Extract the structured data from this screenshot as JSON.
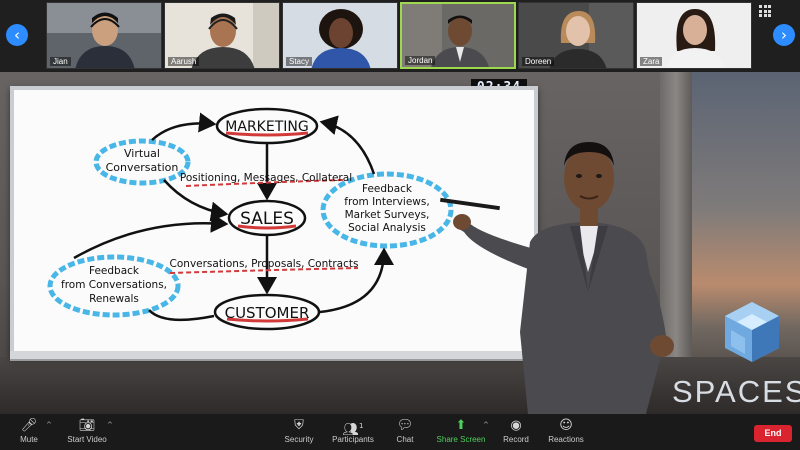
{
  "participants": [
    {
      "name": "Jian",
      "active": false,
      "skin": "#caa07e",
      "shirt": "#2a2f3a",
      "bg": "#8a8f96"
    },
    {
      "name": "Aarush",
      "active": false,
      "skin": "#a87452",
      "shirt": "#3d3d3d",
      "bg": "#e7e3da"
    },
    {
      "name": "Stacy",
      "active": false,
      "skin": "#6b4330",
      "shirt": "#2f56a8",
      "bg": "#d5dce4"
    },
    {
      "name": "Jordan",
      "active": true,
      "skin": "#6f4a33",
      "shirt": "#4a4a4f",
      "bg": "#6b6966"
    },
    {
      "name": "Doreen",
      "active": false,
      "skin": "#e3c2ab",
      "shirt": "#2b2b2b",
      "bg": "#4a4a4a"
    },
    {
      "name": "Zara",
      "active": false,
      "skin": "#d8b098",
      "shirt": "#f2f2f2",
      "bg": "#efefef"
    }
  ],
  "timer": "02:34",
  "whiteboard": {
    "marketing": "MARKETING",
    "sales": "SALES",
    "customer": "CUSTOMER",
    "virtual_line1": "Virtual",
    "virtual_line2": "Conversation",
    "positioning": "Positioning, Messages, Collateral",
    "conversations": "Conversations, Proposals, Contracts",
    "fb_right_line1": "Feedback",
    "fb_right_line2": "from Interviews,",
    "fb_right_line3": "Market Surveys,",
    "fb_right_line4": "Social Analysis",
    "fb_left_line1": "Feedback",
    "fb_left_line2": "from Conversations,",
    "fb_left_line3": "Renewals"
  },
  "brand": "SPACES",
  "toolbar": {
    "mute": "Mute",
    "start_video": "Start Video",
    "security": "Security",
    "participants": "Participants",
    "participants_count": "1",
    "chat": "Chat",
    "share_screen": "Share Screen",
    "record": "Record",
    "reactions": "Reactions",
    "end": "End"
  },
  "colors": {
    "accent_blue": "#2d8cff",
    "active_green": "#9ed84e",
    "share_green": "#4fcf5d",
    "end_red": "#d9232f",
    "ellipse_blue": "#48b6e6",
    "underline_red": "#d23a3a"
  }
}
